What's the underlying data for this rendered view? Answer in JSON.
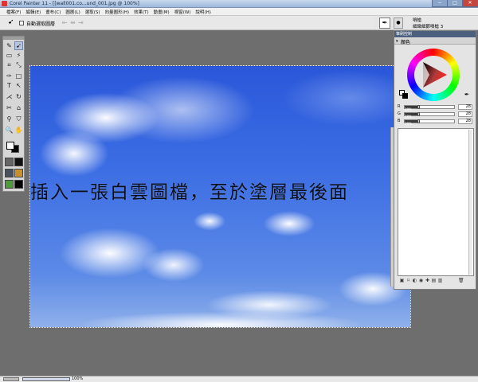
{
  "window": {
    "title": "Corel Painter 11 - [[wall001.co...und_001.jpg @ 100%]",
    "minimize": "−",
    "maximize": "□",
    "close": "✕"
  },
  "menu": {
    "items": [
      "檔案(F)",
      "編輯(E)",
      "畫布(C)",
      "圖層(L)",
      "選取(S)",
      "向量圖形(H)",
      "效果(T)",
      "動畫(M)",
      "視窗(W)",
      "說明(H)"
    ]
  },
  "toolbar": {
    "auto_select_label": "自動選取圖層"
  },
  "brush": {
    "category": "噴槍",
    "variant": "細緻細節噴槍 3"
  },
  "panel": {
    "tab_label": "筆刷控制",
    "color_title": "顏色",
    "rgb": [
      {
        "channel": "R",
        "display": "28%",
        "value": "28",
        "fraction": 0.28
      },
      {
        "channel": "G",
        "display": "28%",
        "value": "28",
        "fraction": 0.28
      },
      {
        "channel": "B",
        "display": "28%",
        "value": "28",
        "fraction": 0.28
      }
    ]
  },
  "canvas": {
    "overlay_text": "插入一張白雲圖檔，至於塗層最後面"
  },
  "status": {
    "zoom": "100%"
  },
  "icons": {
    "selector": "arrow-icon",
    "brush": "brush-icon",
    "color_picker": "dropper-icon"
  }
}
